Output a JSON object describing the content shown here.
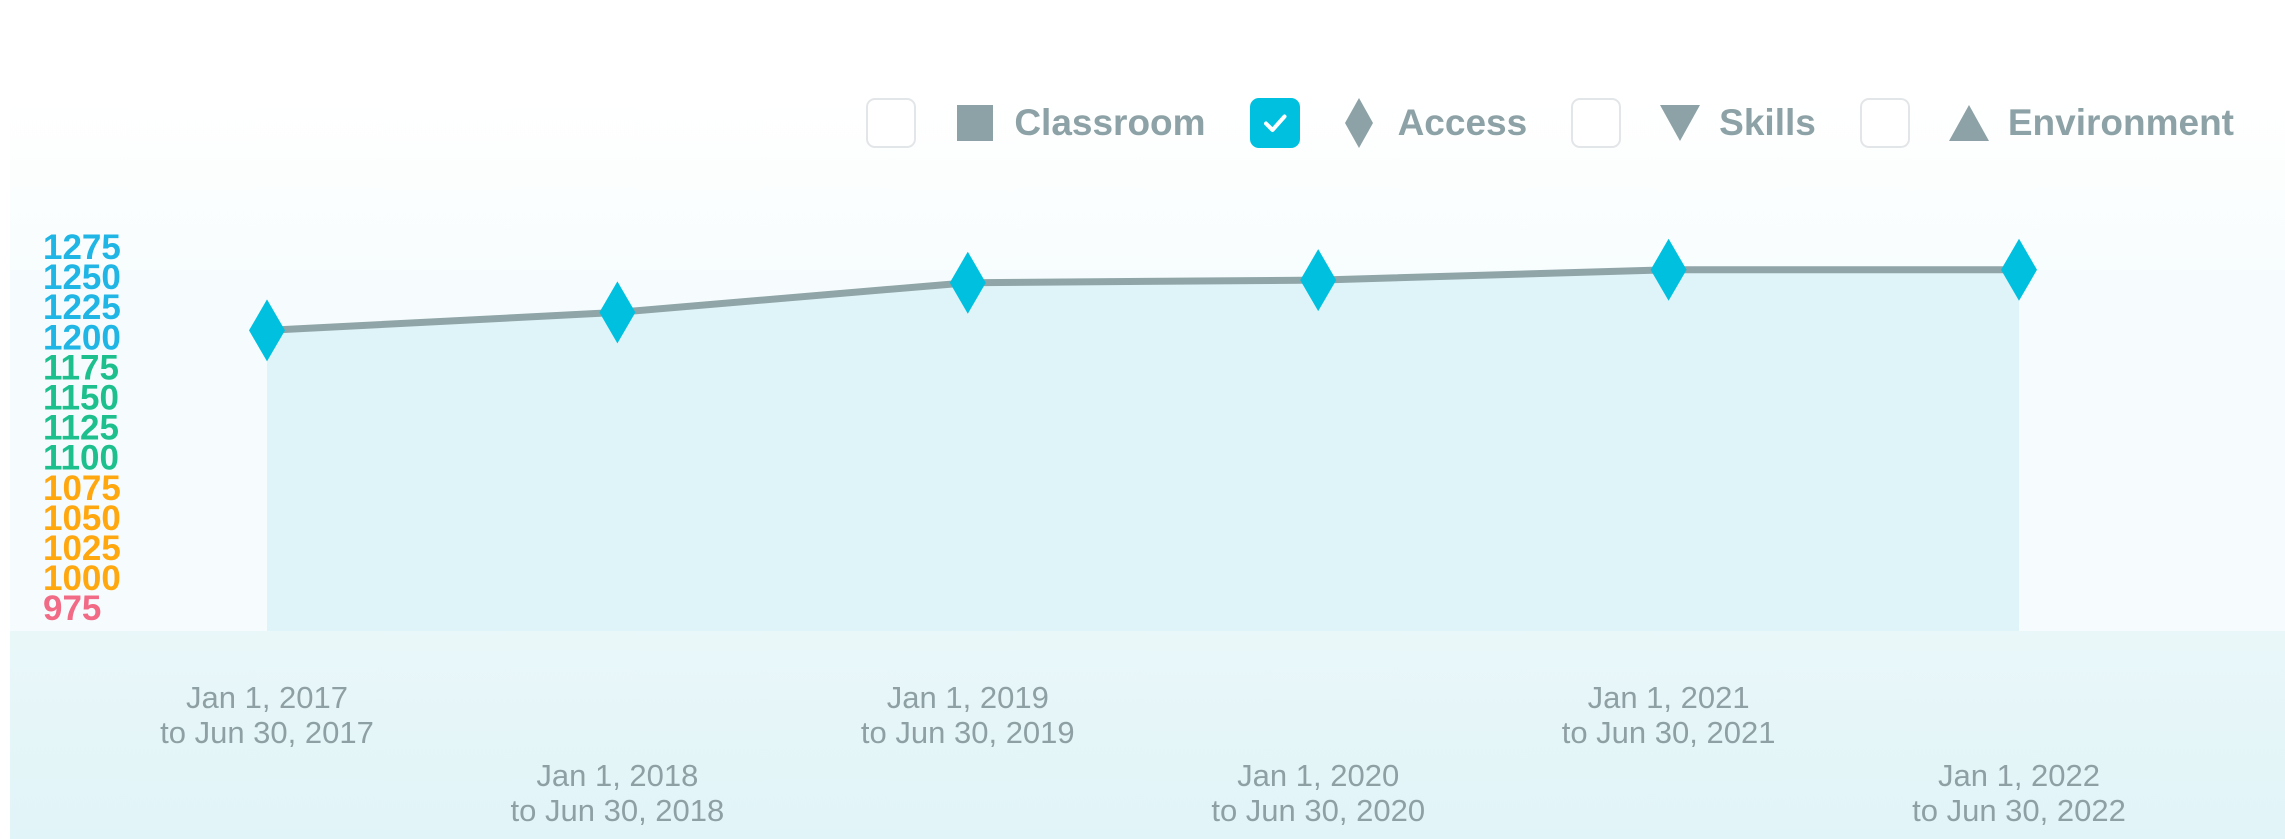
{
  "legend": {
    "items": [
      {
        "label": "Classroom",
        "checked": false,
        "icon": "square-icon"
      },
      {
        "label": "Access",
        "checked": true,
        "icon": "diamond-icon"
      },
      {
        "label": "Skills",
        "checked": false,
        "icon": "triangle-down-icon"
      },
      {
        "label": "Environment",
        "checked": false,
        "icon": "triangle-up-icon"
      }
    ]
  },
  "colors": {
    "line": "#8fa5a8",
    "marker": "#00c0e0",
    "area": "#dff4f8",
    "legend_marker": "#8da2a6",
    "tick_blue": "#1fb5e4",
    "tick_green": "#1dc08d",
    "tick_orange": "#ffa70f",
    "tick_red": "#f26b86",
    "x_label": "#8fa0a4"
  },
  "chart_data": {
    "type": "area",
    "title": "",
    "xlabel": "",
    "ylabel": "",
    "ylim": [
      975,
      1275
    ],
    "y_ticks": [
      {
        "value": 1275,
        "label": "1275",
        "color": "tick_blue"
      },
      {
        "value": 1250,
        "label": "1250",
        "color": "tick_blue"
      },
      {
        "value": 1225,
        "label": "1225",
        "color": "tick_blue"
      },
      {
        "value": 1200,
        "label": "1200",
        "color": "tick_blue"
      },
      {
        "value": 1175,
        "label": "1175",
        "color": "tick_green"
      },
      {
        "value": 1150,
        "label": "1150",
        "color": "tick_green"
      },
      {
        "value": 1125,
        "label": "1125",
        "color": "tick_green"
      },
      {
        "value": 1100,
        "label": "1100",
        "color": "tick_green"
      },
      {
        "value": 1075,
        "label": "1075",
        "color": "tick_orange"
      },
      {
        "value": 1050,
        "label": "1050",
        "color": "tick_orange"
      },
      {
        "value": 1025,
        "label": "1025",
        "color": "tick_orange"
      },
      {
        "value": 1000,
        "label": "1000",
        "color": "tick_orange"
      },
      {
        "value": 975,
        "label": "975",
        "color": "tick_red"
      }
    ],
    "categories": [
      [
        "Jan 1, 2017",
        "to Jun 30, 2017"
      ],
      [
        "Jan 1, 2018",
        "to Jun 30, 2018"
      ],
      [
        "Jan 1, 2019",
        "to Jun 30, 2019"
      ],
      [
        "Jan 1, 2020",
        "to Jun 30, 2020"
      ],
      [
        "Jan 1, 2021",
        "to Jun 30, 2021"
      ],
      [
        "Jan 1, 2022",
        "to Jun 30, 2022"
      ]
    ],
    "series": [
      {
        "name": "Access",
        "values": [
          1208,
          1222,
          1245,
          1247,
          1255,
          1255
        ]
      }
    ],
    "legend_position": "top-right",
    "grid": false
  }
}
